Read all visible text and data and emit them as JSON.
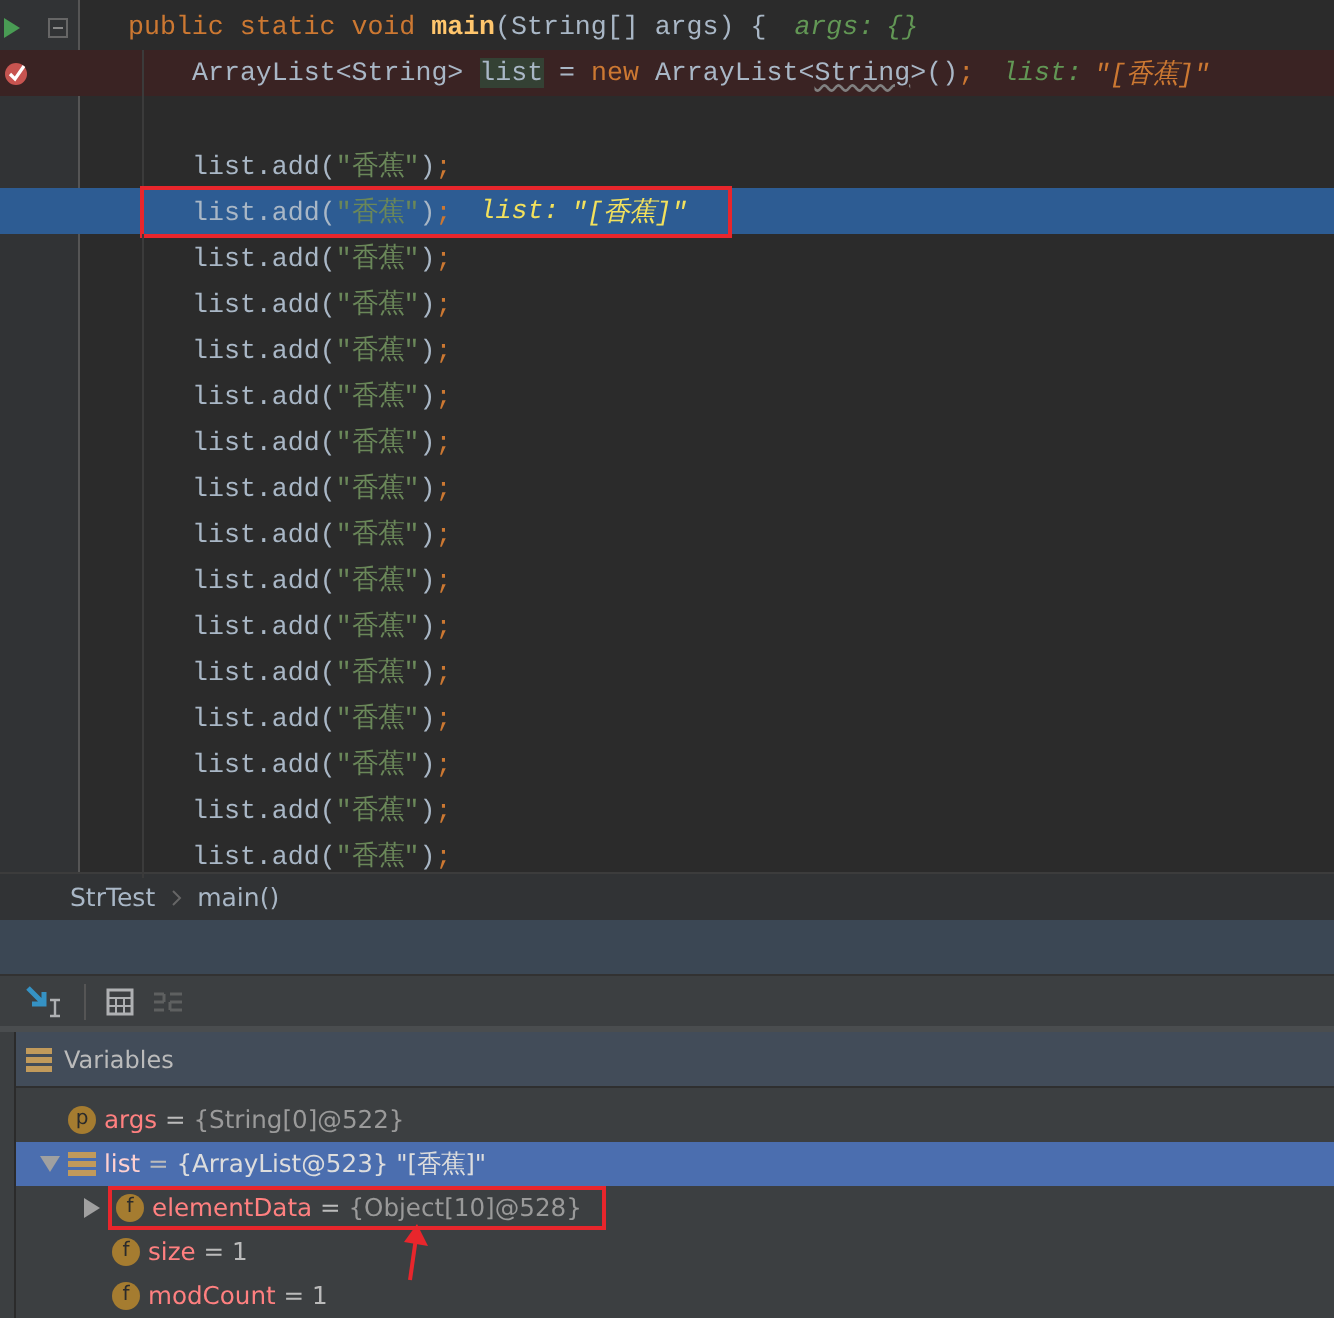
{
  "editor": {
    "method": {
      "header": {
        "segments": [
          {
            "kind": "keyword",
            "text": "public static void "
          },
          {
            "kind": "method",
            "text": "main"
          },
          {
            "kind": "plain",
            "text": "(String[] args) {"
          }
        ],
        "hint": {
          "label": "args:",
          "value": "{}",
          "kind": "object"
        }
      },
      "body": [
        {
          "breakpoint": true,
          "current": false,
          "boxed": false,
          "segments": [
            {
              "kind": "plain",
              "text": "ArrayList<String> "
            },
            {
              "kind": "usage",
              "text": "list"
            },
            {
              "kind": "plain",
              "text": " = "
            },
            {
              "kind": "keyword",
              "text": "new "
            },
            {
              "kind": "plain",
              "text": "ArrayList<"
            },
            {
              "kind": "warning",
              "text": "String"
            },
            {
              "kind": "plain",
              "text": ">()"
            },
            {
              "kind": "punct",
              "text": ";"
            }
          ],
          "hint": {
            "label": "list:",
            "value": "\"[香蕉]\"",
            "kind": "string"
          }
        },
        {
          "breakpoint": false,
          "current": false,
          "boxed": false
        },
        {
          "breakpoint": false,
          "current": false,
          "boxed": false,
          "segments": [
            {
              "kind": "plain",
              "text": "list.add("
            },
            {
              "kind": "string",
              "text": "\"香蕉\""
            },
            {
              "kind": "plain",
              "text": ")"
            },
            {
              "kind": "punct",
              "text": ";"
            }
          ]
        },
        {
          "breakpoint": false,
          "current": true,
          "boxed": true,
          "segments": [
            {
              "kind": "plain",
              "text": "list.add("
            },
            {
              "kind": "string",
              "text": "\"香蕉\""
            },
            {
              "kind": "plain",
              "text": ")"
            },
            {
              "kind": "punct",
              "text": ";"
            }
          ],
          "hint": {
            "label": "list:",
            "value": "\"[香蕉]\"",
            "kind": "string"
          }
        },
        {
          "breakpoint": false,
          "current": false,
          "boxed": false,
          "segments": [
            {
              "kind": "plain",
              "text": "list.add("
            },
            {
              "kind": "string",
              "text": "\"香蕉\""
            },
            {
              "kind": "plain",
              "text": ")"
            },
            {
              "kind": "punct",
              "text": ";"
            }
          ]
        },
        {
          "breakpoint": false,
          "current": false,
          "boxed": false,
          "segments": [
            {
              "kind": "plain",
              "text": "list.add("
            },
            {
              "kind": "string",
              "text": "\"香蕉\""
            },
            {
              "kind": "plain",
              "text": ")"
            },
            {
              "kind": "punct",
              "text": ";"
            }
          ]
        },
        {
          "breakpoint": false,
          "current": false,
          "boxed": false,
          "segments": [
            {
              "kind": "plain",
              "text": "list.add("
            },
            {
              "kind": "string",
              "text": "\"香蕉\""
            },
            {
              "kind": "plain",
              "text": ")"
            },
            {
              "kind": "punct",
              "text": ";"
            }
          ]
        },
        {
          "breakpoint": false,
          "current": false,
          "boxed": false,
          "segments": [
            {
              "kind": "plain",
              "text": "list.add("
            },
            {
              "kind": "string",
              "text": "\"香蕉\""
            },
            {
              "kind": "plain",
              "text": ")"
            },
            {
              "kind": "punct",
              "text": ";"
            }
          ]
        },
        {
          "breakpoint": false,
          "current": false,
          "boxed": false,
          "segments": [
            {
              "kind": "plain",
              "text": "list.add("
            },
            {
              "kind": "string",
              "text": "\"香蕉\""
            },
            {
              "kind": "plain",
              "text": ")"
            },
            {
              "kind": "punct",
              "text": ";"
            }
          ]
        },
        {
          "breakpoint": false,
          "current": false,
          "boxed": false,
          "segments": [
            {
              "kind": "plain",
              "text": "list.add("
            },
            {
              "kind": "string",
              "text": "\"香蕉\""
            },
            {
              "kind": "plain",
              "text": ")"
            },
            {
              "kind": "punct",
              "text": ";"
            }
          ]
        },
        {
          "breakpoint": false,
          "current": false,
          "boxed": false,
          "segments": [
            {
              "kind": "plain",
              "text": "list.add("
            },
            {
              "kind": "string",
              "text": "\"香蕉\""
            },
            {
              "kind": "plain",
              "text": ")"
            },
            {
              "kind": "punct",
              "text": ";"
            }
          ]
        },
        {
          "breakpoint": false,
          "current": false,
          "boxed": false,
          "segments": [
            {
              "kind": "plain",
              "text": "list.add("
            },
            {
              "kind": "string",
              "text": "\"香蕉\""
            },
            {
              "kind": "plain",
              "text": ")"
            },
            {
              "kind": "punct",
              "text": ";"
            }
          ]
        },
        {
          "breakpoint": false,
          "current": false,
          "boxed": false,
          "segments": [
            {
              "kind": "plain",
              "text": "list.add("
            },
            {
              "kind": "string",
              "text": "\"香蕉\""
            },
            {
              "kind": "plain",
              "text": ")"
            },
            {
              "kind": "punct",
              "text": ";"
            }
          ]
        },
        {
          "breakpoint": false,
          "current": false,
          "boxed": false,
          "segments": [
            {
              "kind": "plain",
              "text": "list.add("
            },
            {
              "kind": "string",
              "text": "\"香蕉\""
            },
            {
              "kind": "plain",
              "text": ")"
            },
            {
              "kind": "punct",
              "text": ";"
            }
          ]
        },
        {
          "breakpoint": false,
          "current": false,
          "boxed": false,
          "segments": [
            {
              "kind": "plain",
              "text": "list.add("
            },
            {
              "kind": "string",
              "text": "\"香蕉\""
            },
            {
              "kind": "plain",
              "text": ")"
            },
            {
              "kind": "punct",
              "text": ";"
            }
          ]
        },
        {
          "breakpoint": false,
          "current": false,
          "boxed": false,
          "segments": [
            {
              "kind": "plain",
              "text": "list.add("
            },
            {
              "kind": "string",
              "text": "\"香蕉\""
            },
            {
              "kind": "plain",
              "text": ")"
            },
            {
              "kind": "punct",
              "text": ";"
            }
          ]
        },
        {
          "breakpoint": false,
          "current": false,
          "boxed": false,
          "segments": [
            {
              "kind": "plain",
              "text": "list.add("
            },
            {
              "kind": "string",
              "text": "\"香蕉\""
            },
            {
              "kind": "plain",
              "text": ")"
            },
            {
              "kind": "punct",
              "text": ";"
            }
          ]
        },
        {
          "breakpoint": false,
          "current": false,
          "boxed": false,
          "segments": [
            {
              "kind": "plain",
              "text": "list.add("
            },
            {
              "kind": "string",
              "text": "\"香蕉\""
            },
            {
              "kind": "plain",
              "text": ")"
            },
            {
              "kind": "punct",
              "text": ";"
            }
          ]
        }
      ]
    }
  },
  "breadcrumbs": [
    {
      "text": "StrTest"
    },
    {
      "text": "main()"
    }
  ],
  "variables": {
    "title": "Variables",
    "items": [
      {
        "kind": "param",
        "badge": "p",
        "name": "args",
        "operator": "=",
        "value": "{String[0]@522}",
        "selected": false,
        "boxed": false
      },
      {
        "kind": "local",
        "name": "list",
        "operator": "=",
        "value": "{ArrayList@523}",
        "summary": "\"[香蕉]\"",
        "selected": true,
        "boxed": false,
        "expanded": true,
        "children": [
          {
            "kind": "field",
            "badge": "f",
            "name": "elementData",
            "operator": "=",
            "value": "{Object[10]@528}",
            "selected": false,
            "boxed": true,
            "expanded": false
          },
          {
            "kind": "field",
            "badge": "f",
            "name": "size",
            "operator": "=",
            "value": "1",
            "selected": false,
            "boxed": false
          },
          {
            "kind": "field",
            "badge": "f",
            "name": "modCount",
            "operator": "=",
            "value": "1",
            "selected": false,
            "boxed": false
          }
        ]
      }
    ]
  }
}
